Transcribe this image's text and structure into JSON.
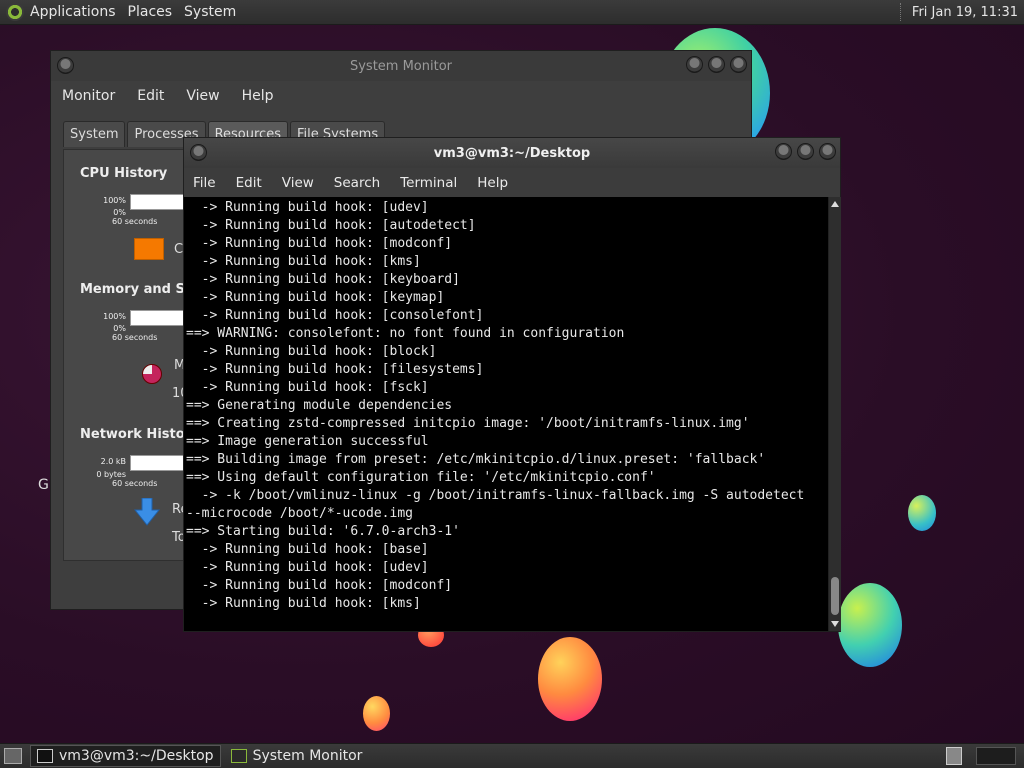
{
  "top_panel": {
    "menus": [
      "Applications",
      "Places",
      "System"
    ],
    "clock": "Fri Jan 19, 11:31"
  },
  "desktop": {
    "partial_label": "G"
  },
  "system_monitor": {
    "title": "System Monitor",
    "menu": [
      "Monitor",
      "Edit",
      "View",
      "Help"
    ],
    "tabs": [
      "System",
      "Processes",
      "Resources",
      "File Systems"
    ],
    "active_tab": "Resources",
    "sections": {
      "cpu": {
        "title": "CPU History",
        "top": "100%",
        "bottom": "0%",
        "span": "60 seconds",
        "legend_partial": "C"
      },
      "memory": {
        "title": "Memory and Swa",
        "top": "100%",
        "bottom": "0%",
        "span": "60 seconds",
        "label_partial": "M",
        "value_partial": "10"
      },
      "network": {
        "title": "Network History",
        "top": "2.0 kB",
        "bottom": "0 bytes",
        "span": "60 seconds",
        "recv_partial": "Re",
        "total_partial": "To"
      }
    },
    "cpu_color": "#f57900"
  },
  "terminal": {
    "title": "vm3@vm3:~/Desktop",
    "menu": [
      "File",
      "Edit",
      "View",
      "Search",
      "Terminal",
      "Help"
    ],
    "lines": [
      "  -> Running build hook: [udev]",
      "  -> Running build hook: [autodetect]",
      "  -> Running build hook: [modconf]",
      "  -> Running build hook: [kms]",
      "  -> Running build hook: [keyboard]",
      "  -> Running build hook: [keymap]",
      "  -> Running build hook: [consolefont]",
      "==> WARNING: consolefont: no font found in configuration",
      "  -> Running build hook: [block]",
      "  -> Running build hook: [filesystems]",
      "  -> Running build hook: [fsck]",
      "==> Generating module dependencies",
      "==> Creating zstd-compressed initcpio image: '/boot/initramfs-linux.img'",
      "==> Image generation successful",
      "==> Building image from preset: /etc/mkinitcpio.d/linux.preset: 'fallback'",
      "==> Using default configuration file: '/etc/mkinitcpio.conf'",
      "  -> -k /boot/vmlinuz-linux -g /boot/initramfs-linux-fallback.img -S autodetect",
      "--microcode /boot/*-ucode.img",
      "==> Starting build: '6.7.0-arch3-1'",
      "  -> Running build hook: [base]",
      "  -> Running build hook: [udev]",
      "  -> Running build hook: [modconf]",
      "  -> Running build hook: [kms]"
    ]
  },
  "taskbar": {
    "tasks": [
      "vm3@vm3:~/Desktop",
      "System Monitor"
    ],
    "active_task": "vm3@vm3:~/Desktop"
  }
}
